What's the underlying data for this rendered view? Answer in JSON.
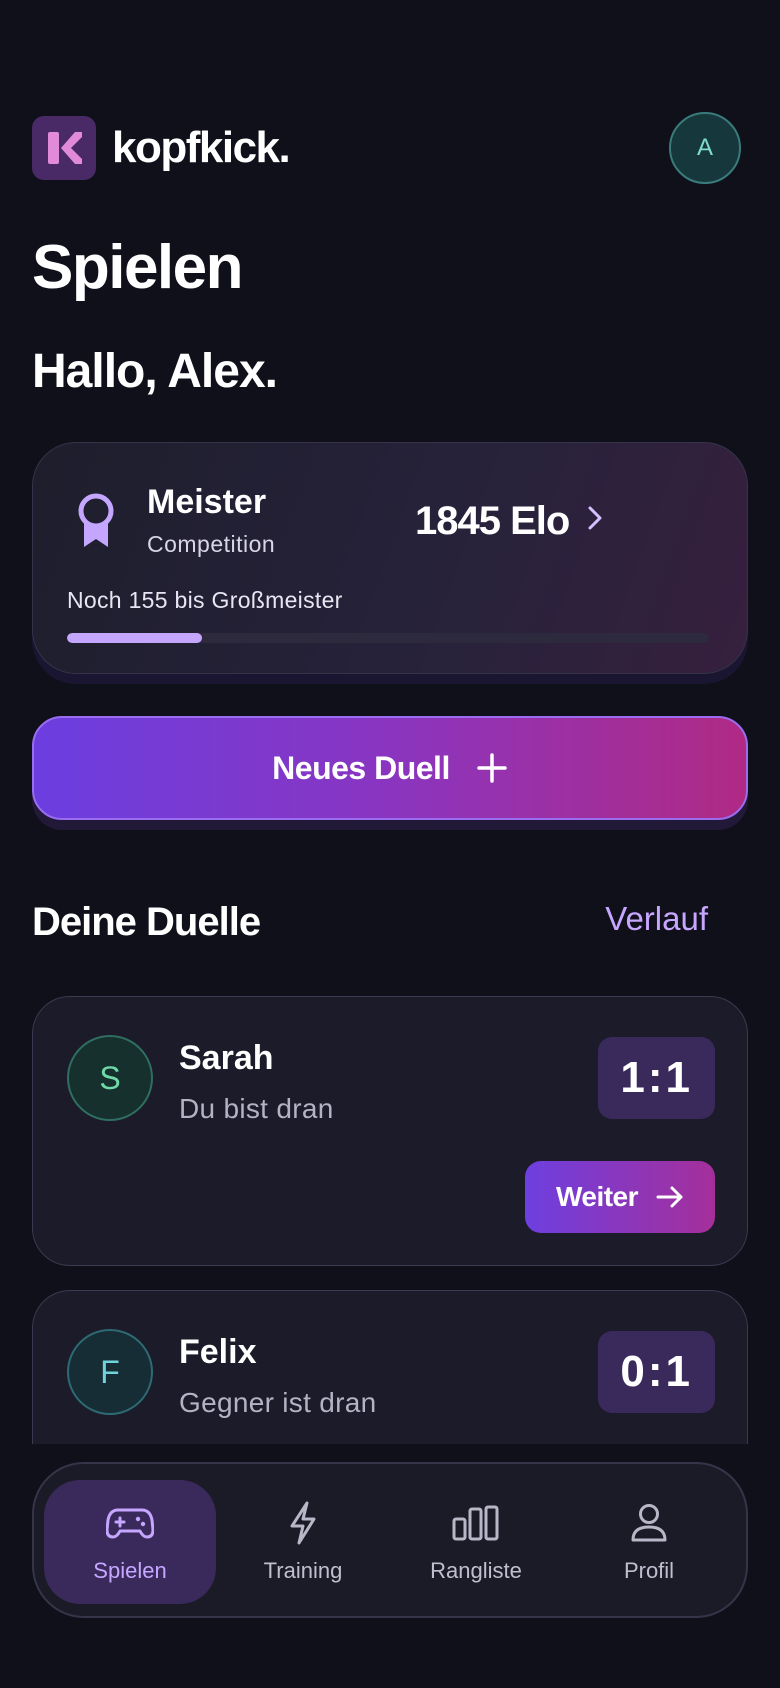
{
  "header": {
    "brand_name": "kopfkick.",
    "logo_letter": "K",
    "avatar_initial": "A"
  },
  "page": {
    "title": "Spielen",
    "greeting": "Hallo, Alex."
  },
  "rank": {
    "name": "Meister",
    "category": "Competition",
    "elo": "1845 Elo",
    "progress_text": "Noch 155 bis Großmeister",
    "progress_fraction": 0.21,
    "icon": "award-ribbon-icon"
  },
  "new_duel": {
    "label": "Neues Duell",
    "icon": "plus-icon"
  },
  "duels_section": {
    "title": "Deine Duelle",
    "history_link": "Verlauf"
  },
  "duels": [
    {
      "initial": "S",
      "name": "Sarah",
      "status": "Du bist dran",
      "score": "1:1",
      "action": "Weiter"
    },
    {
      "initial": "F",
      "name": "Felix",
      "status": "Gegner ist dran",
      "score": "0:1"
    }
  ],
  "nav": {
    "items": [
      {
        "label": "Spielen",
        "icon": "gamepad-icon",
        "active": true
      },
      {
        "label": "Training",
        "icon": "lightning-icon",
        "active": false
      },
      {
        "label": "Rangliste",
        "icon": "leaderboard-icon",
        "active": false
      },
      {
        "label": "Profil",
        "icon": "user-icon",
        "active": false
      }
    ]
  },
  "colors": {
    "background": "#10101a",
    "accent_purple": "#c7a6ff",
    "gradient_start": "#6b3ee0",
    "gradient_end": "#b02a84"
  }
}
